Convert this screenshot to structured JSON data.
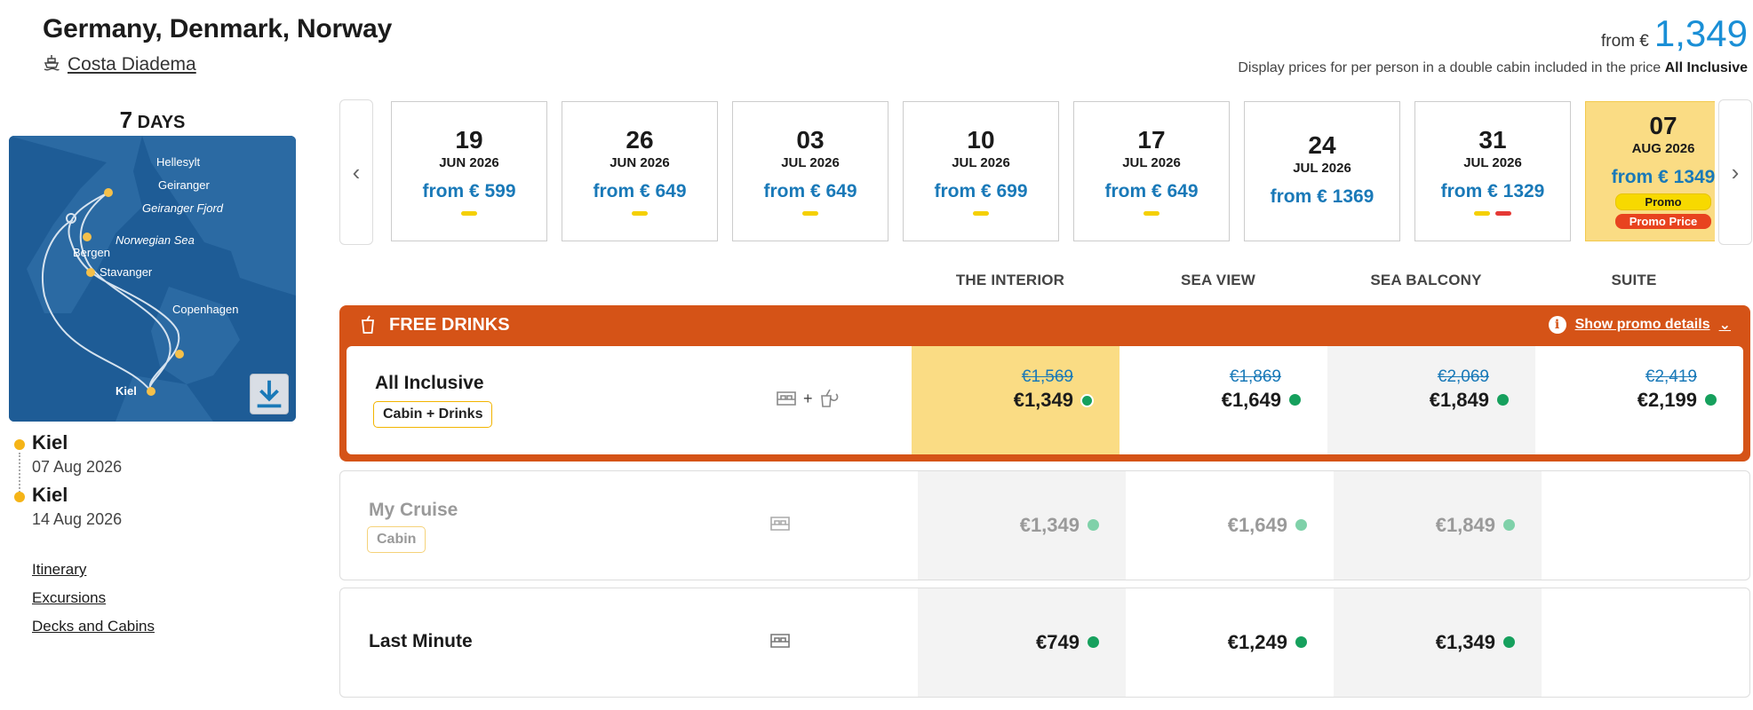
{
  "header": {
    "title": "Germany, Denmark, Norway",
    "ship": "Costa Diadema",
    "from_label": "from €",
    "price": "1,349",
    "note": "Display prices for per person in a double cabin included in the price",
    "note_bold": "All Inclusive"
  },
  "trip": {
    "days_num": "7",
    "days_label": "DAYS",
    "map_labels": [
      "Hellesylt",
      "Geiranger",
      "Geiranger Fjord",
      "Norwegian Sea",
      "Bergen",
      "Stavanger",
      "Copenhagen",
      "Kiel"
    ],
    "stops": [
      {
        "name": "Kiel",
        "date": "07 Aug 2026"
      },
      {
        "name": "Kiel",
        "date": "14 Aug 2026"
      }
    ],
    "links": [
      "Itinerary",
      "Excursions",
      "Decks and Cabins"
    ]
  },
  "dates": [
    {
      "day": "19",
      "month_year": "JUN 2026",
      "from": "from € 599",
      "bars": [
        "yellow"
      ]
    },
    {
      "day": "26",
      "month_year": "JUN 2026",
      "from": "from € 649",
      "bars": [
        "yellow"
      ]
    },
    {
      "day": "03",
      "month_year": "JUL 2026",
      "from": "from € 649",
      "bars": [
        "yellow"
      ]
    },
    {
      "day": "10",
      "month_year": "JUL 2026",
      "from": "from € 699",
      "bars": [
        "yellow"
      ]
    },
    {
      "day": "17",
      "month_year": "JUL 2026",
      "from": "from € 649",
      "bars": [
        "yellow"
      ]
    },
    {
      "day": "24",
      "month_year": "JUL 2026",
      "from": "from € 1369",
      "bars": []
    },
    {
      "day": "31",
      "month_year": "JUL 2026",
      "from": "from € 1329",
      "bars": [
        "yellow",
        "red"
      ]
    },
    {
      "day": "07",
      "month_year": "AUG 2026",
      "from": "from € 1349",
      "bars": [],
      "selected": true,
      "badges": [
        "Promo",
        "Promo Price"
      ]
    }
  ],
  "columns": [
    "THE INTERIOR",
    "SEA VIEW",
    "SEA BALCONY",
    "SUITE"
  ],
  "promo": {
    "label": "FREE DRINKS",
    "details": "Show promo details"
  },
  "rows": [
    {
      "name": "All Inclusive",
      "tag": "Cabin + Drinks",
      "icons": "cabin + drinks",
      "prices": [
        {
          "old": "€1,569",
          "new": "€1,349"
        },
        {
          "old": "€1,869",
          "new": "€1,649"
        },
        {
          "old": "€2,069",
          "new": "€1,849"
        },
        {
          "old": "€2,419",
          "new": "€2,199"
        }
      ]
    },
    {
      "name": "My Cruise",
      "tag": "Cabin",
      "icons": "cabin",
      "prices": [
        {
          "new": "€1,349"
        },
        {
          "new": "€1,649"
        },
        {
          "new": "€1,849"
        }
      ]
    },
    {
      "name": "Last Minute",
      "tag": "",
      "icons": "cabin",
      "prices": [
        {
          "new": "€749"
        },
        {
          "new": "€1,249"
        },
        {
          "new": "€1,349"
        }
      ]
    }
  ],
  "colors": {
    "accent_blue": "#1979b8",
    "promo_orange": "#d55317",
    "highlight_yellow": "#fadc84",
    "available_green": "#16a05d"
  }
}
